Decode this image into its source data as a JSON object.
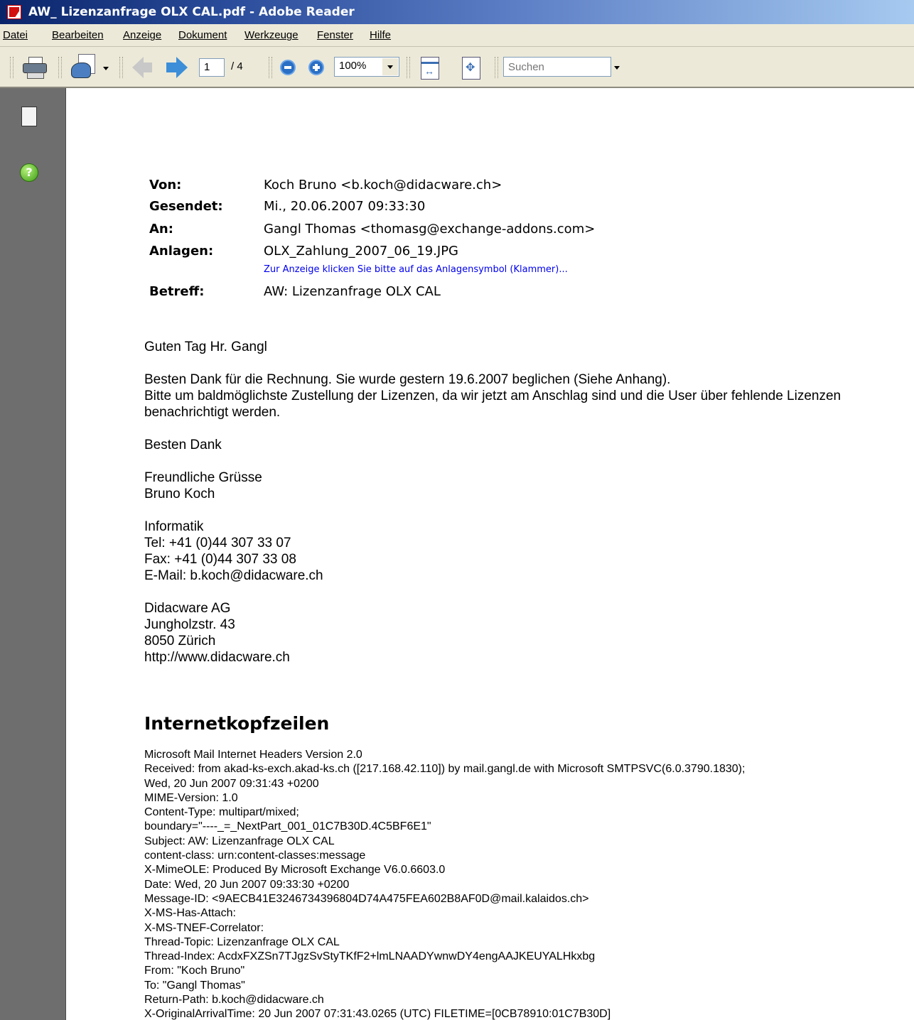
{
  "window": {
    "title": "AW_ Lizenzanfrage OLX CAL.pdf - Adobe Reader"
  },
  "menu": [
    "Datei",
    "Bearbeiten",
    "Anzeige",
    "Dokument",
    "Werkzeuge",
    "Fenster",
    "Hilfe"
  ],
  "toolbar": {
    "page_current": "1",
    "page_total": "/ 4",
    "zoom": "100%",
    "search_placeholder": "Suchen"
  },
  "sidebar": {
    "icons": [
      "pages-icon",
      "help-icon"
    ],
    "help_glyph": "?"
  },
  "email": {
    "labels": {
      "from": "Von:",
      "sent": "Gesendet:",
      "to": "An:",
      "attachments": "Anlagen:",
      "subject": "Betreff:"
    },
    "from": "Koch Bruno <b.koch@didacware.ch>",
    "sent": "Mi., 20.06.2007 09:33:30",
    "to": "Gangl Thomas <thomasg@exchange-addons.com>",
    "attachment": "OLX_Zahlung_2007_06_19.JPG",
    "attachment_note": "Zur Anzeige klicken Sie bitte auf das Anlagensymbol (Klammer)...",
    "subject": "AW: Lizenzanfrage OLX CAL",
    "greeting": "Guten Tag Hr. Gangl",
    "body_line1": "Besten Dank für die Rechnung. Sie wurde gestern 19.6.2007 beglichen (Siehe Anhang).",
    "body_line2": "Bitte um baldmöglichste Zustellung der Lizenzen, da wir jetzt am Anschlag sind und die User über fehlende Lizenzen",
    "body_line3": "benachrichtigt werden.",
    "thanks": "Besten Dank",
    "closing": "Freundliche Grüsse",
    "name": "Bruno Koch",
    "dept": "Informatik",
    "tel": "Tel: +41 (0)44 307 33 07",
    "fax": "Fax: +41 (0)44 307 33 08",
    "email_line": "E-Mail: b.koch@didacware.ch",
    "company": "Didacware AG",
    "street": "Jungholzstr. 43",
    "city": "8050 Zürich",
    "web": "http://www.didacware.ch"
  },
  "internet_headers": {
    "title": "Internetkopfzeilen",
    "lines": [
      "Microsoft Mail Internet Headers Version 2.0",
      "Received: from akad-ks-exch.akad-ks.ch ([217.168.42.110]) by mail.gangl.de with Microsoft SMTPSVC(6.0.3790.1830);",
      "Wed, 20 Jun 2007 09:31:43 +0200",
      "MIME-Version: 1.0",
      "Content-Type: multipart/mixed;",
      "boundary=\"----_=_NextPart_001_01C7B30D.4C5BF6E1\"",
      "Subject: AW: Lizenzanfrage OLX CAL",
      "content-class: urn:content-classes:message",
      "X-MimeOLE: Produced By Microsoft Exchange V6.0.6603.0",
      "Date: Wed, 20 Jun 2007 09:33:30 +0200",
      "Message-ID: <9AECB41E3246734396804D74A475FEA602B8AF0D@mail.kalaidos.ch>",
      "X-MS-Has-Attach:",
      "X-MS-TNEF-Correlator:",
      "Thread-Topic: Lizenzanfrage OLX CAL",
      "Thread-Index: AcdxFXZSn7TJgzSvStyTKfF2+lmLNAADYwnwDY4engAAJKEUYALHkxbg",
      "From: \"Koch Bruno\"",
      "To: \"Gangl Thomas\"",
      "Return-Path: b.koch@didacware.ch",
      "X-OriginalArrivalTime: 20 Jun 2007 07:31:43.0265 (UTC) FILETIME=[0CB78910:01C7B30D]"
    ]
  }
}
